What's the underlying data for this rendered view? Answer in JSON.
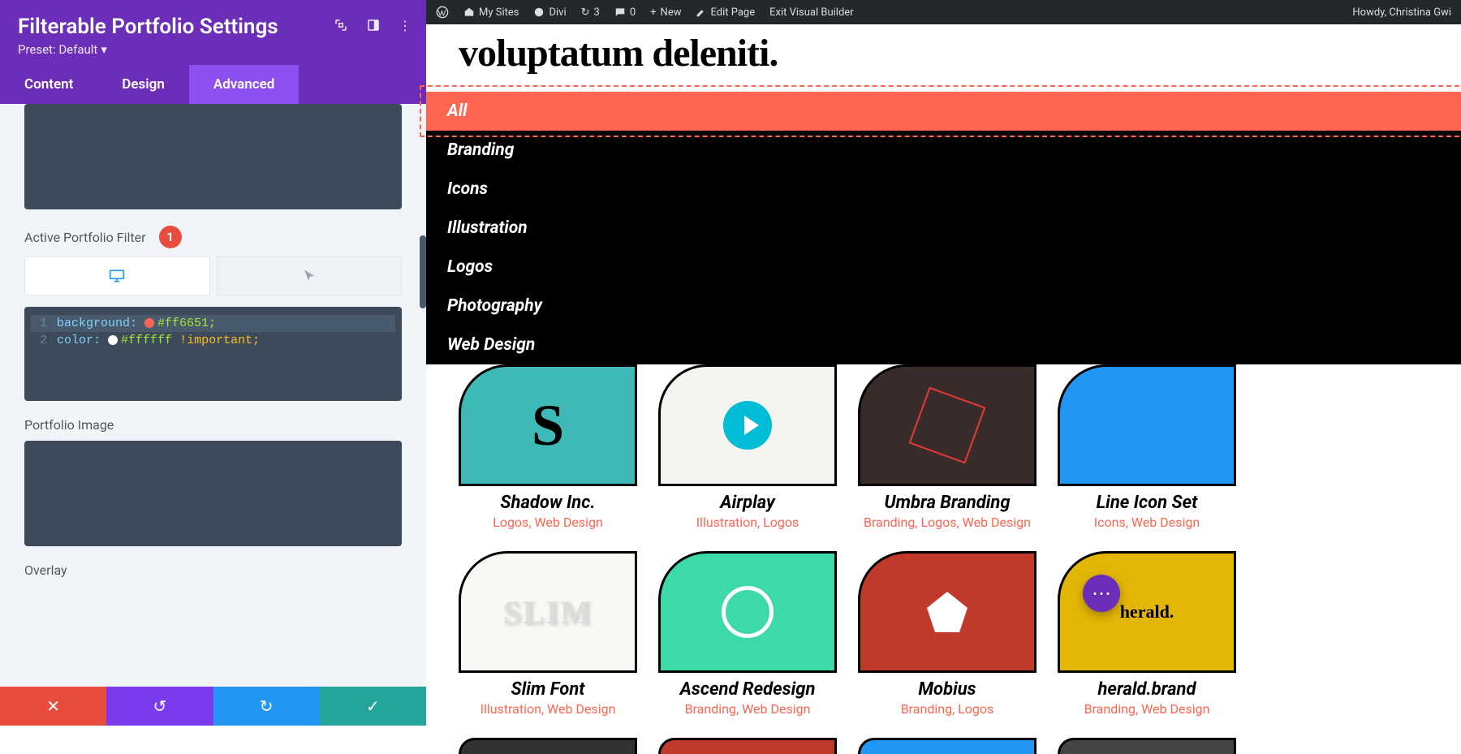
{
  "panel": {
    "title": "Filterable Portfolio Settings",
    "preset_label": "Preset: Default",
    "tabs": {
      "content": "Content",
      "design": "Design",
      "advanced": "Advanced"
    },
    "section_active_filter": "Active Portfolio Filter",
    "marker1": "1",
    "code": {
      "line1_prop": "background:",
      "line1_val": "#ff6651;",
      "line2_prop": "color:",
      "line2_val": "#ffffff",
      "line2_imp": "!important;",
      "swatch1": "#ff6651",
      "swatch2": "#ffffff"
    },
    "section_portfolio_image": "Portfolio Image",
    "section_overlay": "Overlay"
  },
  "wpbar": {
    "my_sites": "My Sites",
    "divi": "Divi",
    "refresh_count": "3",
    "comments_count": "0",
    "new": "New",
    "edit_page": "Edit Page",
    "exit_vb": "Exit Visual Builder",
    "greeting": "Howdy, Christina Gwi"
  },
  "preview": {
    "headline": "voluptatum deleniti.",
    "filters": [
      "All",
      "Branding",
      "Icons",
      "Illustration",
      "Logos",
      "Photography",
      "Web Design"
    ],
    "items": [
      {
        "title": "Shadow Inc.",
        "cats": "Logos, Web Design"
      },
      {
        "title": "Airplay",
        "cats": "Illustration, Logos"
      },
      {
        "title": "Umbra Branding",
        "cats": "Branding, Logos, Web Design"
      },
      {
        "title": "Line Icon Set",
        "cats": "Icons, Web Design"
      },
      {
        "title": "Slim Font",
        "cats": "Illustration, Web Design"
      },
      {
        "title": "Ascend Redesign",
        "cats": "Branding, Web Design"
      },
      {
        "title": "Mobius",
        "cats": "Branding, Logos"
      },
      {
        "title": "herald.brand",
        "cats": "Branding, Web Design"
      }
    ]
  }
}
